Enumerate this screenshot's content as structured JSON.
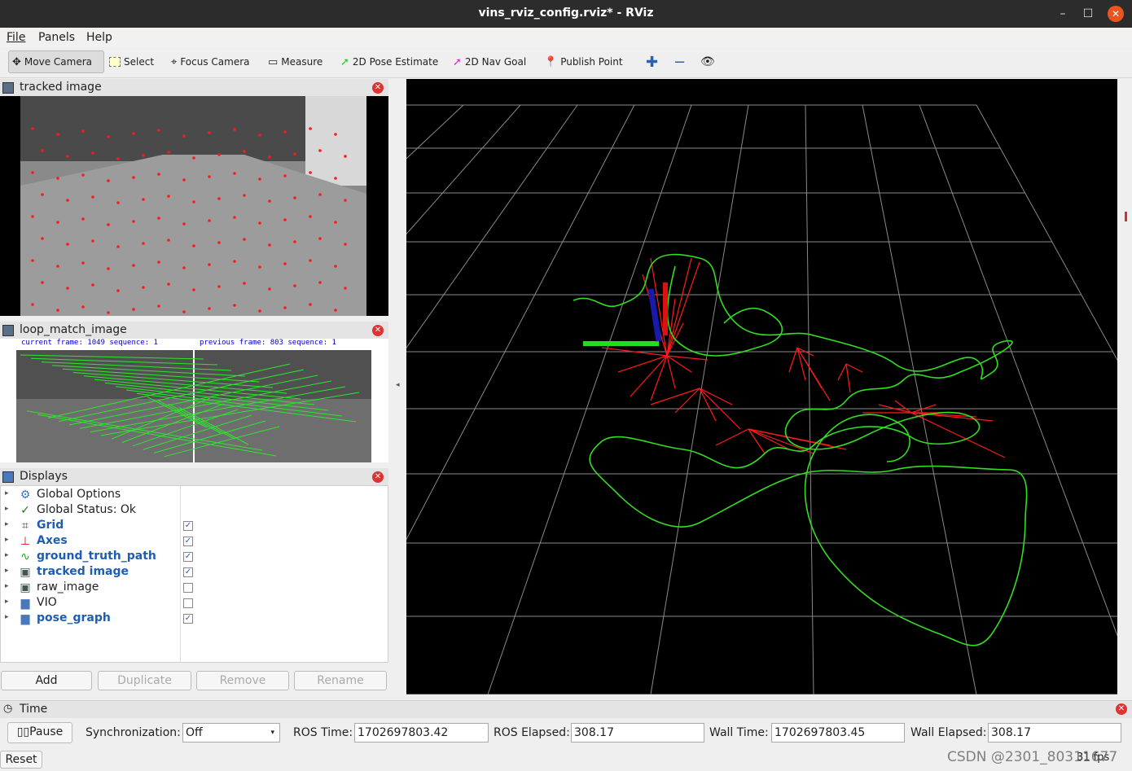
{
  "window": {
    "title": "vins_rviz_config.rviz* - RViz"
  },
  "menu": {
    "file": "File",
    "panels": "Panels",
    "help": "Help"
  },
  "toolbar": {
    "move_camera": "Move Camera",
    "select": "Select",
    "focus_camera": "Focus Camera",
    "measure": "Measure",
    "pose_estimate": "2D Pose Estimate",
    "nav_goal": "2D Nav Goal",
    "publish_point": "Publish Point"
  },
  "panels": {
    "tracked_image": "tracked image",
    "loop_match_image": "loop_match_image",
    "displays": "Displays",
    "time": "Time"
  },
  "loop_match": {
    "current": "current frame: 1049  sequence: 1",
    "previous": "previous frame: 803  sequence: 1"
  },
  "displays": [
    {
      "label": "Global Options",
      "icon": "gear-icon",
      "checked": null,
      "bold": false
    },
    {
      "label": "Global Status: Ok",
      "icon": "check-icon",
      "checked": null,
      "bold": false
    },
    {
      "label": "Grid",
      "icon": "grid-icon",
      "checked": true,
      "bold": true
    },
    {
      "label": "Axes",
      "icon": "axes-icon",
      "checked": true,
      "bold": true
    },
    {
      "label": "ground_truth_path",
      "icon": "path-icon",
      "checked": true,
      "bold": true
    },
    {
      "label": "tracked image",
      "icon": "image-icon",
      "checked": true,
      "bold": true
    },
    {
      "label": "raw_image",
      "icon": "image-icon",
      "checked": false,
      "bold": false
    },
    {
      "label": "VIO",
      "icon": "folder-icon",
      "checked": false,
      "bold": false
    },
    {
      "label": "pose_graph",
      "icon": "folder-icon",
      "checked": true,
      "bold": true
    }
  ],
  "buttons": {
    "add": "Add",
    "duplicate": "Duplicate",
    "remove": "Remove",
    "rename": "Rename"
  },
  "time": {
    "pause": "Pause",
    "sync_label": "Synchronization:",
    "sync_value": "Off",
    "ros_time_label": "ROS Time:",
    "ros_time": "1702697803.42",
    "ros_elapsed_label": "ROS Elapsed:",
    "ros_elapsed": "308.17",
    "wall_time_label": "Wall Time:",
    "wall_time": "1702697803.45",
    "wall_elapsed_label": "Wall Elapsed:",
    "wall_elapsed": "308.17"
  },
  "status": {
    "reset": "Reset",
    "fps": "31 fps",
    "watermark": "CSDN @2301_80311677"
  }
}
